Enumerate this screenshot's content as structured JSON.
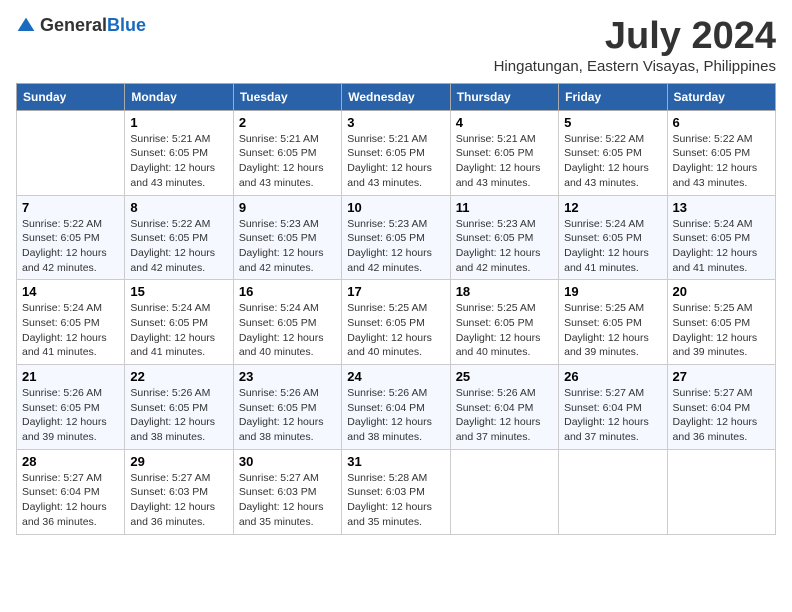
{
  "logo": {
    "general": "General",
    "blue": "Blue"
  },
  "title": "July 2024",
  "subtitle": "Hingatungan, Eastern Visayas, Philippines",
  "headers": [
    "Sunday",
    "Monday",
    "Tuesday",
    "Wednesday",
    "Thursday",
    "Friday",
    "Saturday"
  ],
  "weeks": [
    [
      {
        "date": "",
        "text": ""
      },
      {
        "date": "1",
        "text": "Sunrise: 5:21 AM\nSunset: 6:05 PM\nDaylight: 12 hours\nand 43 minutes."
      },
      {
        "date": "2",
        "text": "Sunrise: 5:21 AM\nSunset: 6:05 PM\nDaylight: 12 hours\nand 43 minutes."
      },
      {
        "date": "3",
        "text": "Sunrise: 5:21 AM\nSunset: 6:05 PM\nDaylight: 12 hours\nand 43 minutes."
      },
      {
        "date": "4",
        "text": "Sunrise: 5:21 AM\nSunset: 6:05 PM\nDaylight: 12 hours\nand 43 minutes."
      },
      {
        "date": "5",
        "text": "Sunrise: 5:22 AM\nSunset: 6:05 PM\nDaylight: 12 hours\nand 43 minutes."
      },
      {
        "date": "6",
        "text": "Sunrise: 5:22 AM\nSunset: 6:05 PM\nDaylight: 12 hours\nand 43 minutes."
      }
    ],
    [
      {
        "date": "7",
        "text": "Sunrise: 5:22 AM\nSunset: 6:05 PM\nDaylight: 12 hours\nand 42 minutes."
      },
      {
        "date": "8",
        "text": "Sunrise: 5:22 AM\nSunset: 6:05 PM\nDaylight: 12 hours\nand 42 minutes."
      },
      {
        "date": "9",
        "text": "Sunrise: 5:23 AM\nSunset: 6:05 PM\nDaylight: 12 hours\nand 42 minutes."
      },
      {
        "date": "10",
        "text": "Sunrise: 5:23 AM\nSunset: 6:05 PM\nDaylight: 12 hours\nand 42 minutes."
      },
      {
        "date": "11",
        "text": "Sunrise: 5:23 AM\nSunset: 6:05 PM\nDaylight: 12 hours\nand 42 minutes."
      },
      {
        "date": "12",
        "text": "Sunrise: 5:24 AM\nSunset: 6:05 PM\nDaylight: 12 hours\nand 41 minutes."
      },
      {
        "date": "13",
        "text": "Sunrise: 5:24 AM\nSunset: 6:05 PM\nDaylight: 12 hours\nand 41 minutes."
      }
    ],
    [
      {
        "date": "14",
        "text": "Sunrise: 5:24 AM\nSunset: 6:05 PM\nDaylight: 12 hours\nand 41 minutes."
      },
      {
        "date": "15",
        "text": "Sunrise: 5:24 AM\nSunset: 6:05 PM\nDaylight: 12 hours\nand 41 minutes."
      },
      {
        "date": "16",
        "text": "Sunrise: 5:24 AM\nSunset: 6:05 PM\nDaylight: 12 hours\nand 40 minutes."
      },
      {
        "date": "17",
        "text": "Sunrise: 5:25 AM\nSunset: 6:05 PM\nDaylight: 12 hours\nand 40 minutes."
      },
      {
        "date": "18",
        "text": "Sunrise: 5:25 AM\nSunset: 6:05 PM\nDaylight: 12 hours\nand 40 minutes."
      },
      {
        "date": "19",
        "text": "Sunrise: 5:25 AM\nSunset: 6:05 PM\nDaylight: 12 hours\nand 39 minutes."
      },
      {
        "date": "20",
        "text": "Sunrise: 5:25 AM\nSunset: 6:05 PM\nDaylight: 12 hours\nand 39 minutes."
      }
    ],
    [
      {
        "date": "21",
        "text": "Sunrise: 5:26 AM\nSunset: 6:05 PM\nDaylight: 12 hours\nand 39 minutes."
      },
      {
        "date": "22",
        "text": "Sunrise: 5:26 AM\nSunset: 6:05 PM\nDaylight: 12 hours\nand 38 minutes."
      },
      {
        "date": "23",
        "text": "Sunrise: 5:26 AM\nSunset: 6:05 PM\nDaylight: 12 hours\nand 38 minutes."
      },
      {
        "date": "24",
        "text": "Sunrise: 5:26 AM\nSunset: 6:04 PM\nDaylight: 12 hours\nand 38 minutes."
      },
      {
        "date": "25",
        "text": "Sunrise: 5:26 AM\nSunset: 6:04 PM\nDaylight: 12 hours\nand 37 minutes."
      },
      {
        "date": "26",
        "text": "Sunrise: 5:27 AM\nSunset: 6:04 PM\nDaylight: 12 hours\nand 37 minutes."
      },
      {
        "date": "27",
        "text": "Sunrise: 5:27 AM\nSunset: 6:04 PM\nDaylight: 12 hours\nand 36 minutes."
      }
    ],
    [
      {
        "date": "28",
        "text": "Sunrise: 5:27 AM\nSunset: 6:04 PM\nDaylight: 12 hours\nand 36 minutes."
      },
      {
        "date": "29",
        "text": "Sunrise: 5:27 AM\nSunset: 6:03 PM\nDaylight: 12 hours\nand 36 minutes."
      },
      {
        "date": "30",
        "text": "Sunrise: 5:27 AM\nSunset: 6:03 PM\nDaylight: 12 hours\nand 35 minutes."
      },
      {
        "date": "31",
        "text": "Sunrise: 5:28 AM\nSunset: 6:03 PM\nDaylight: 12 hours\nand 35 minutes."
      },
      {
        "date": "",
        "text": ""
      },
      {
        "date": "",
        "text": ""
      },
      {
        "date": "",
        "text": ""
      }
    ]
  ]
}
